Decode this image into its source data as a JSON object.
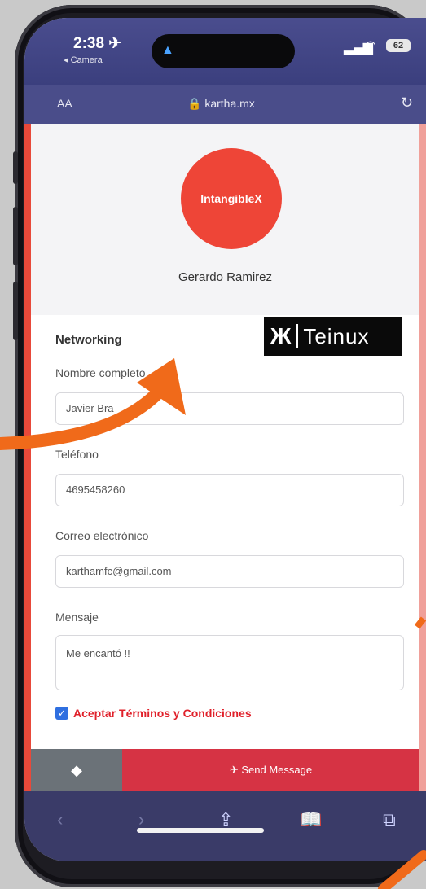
{
  "status": {
    "time": "2:38 ✈",
    "back_app": "◂ Camera",
    "battery": "62"
  },
  "browser": {
    "aa": "AA",
    "url": "🔒 kartha.mx",
    "reload": "↻"
  },
  "profile": {
    "logo_text": "IntangibleX",
    "name": "Gerardo Ramirez"
  },
  "form": {
    "section_title": "Networking",
    "sponsor": "Teinux",
    "fields": [
      {
        "label": "Nombre completo",
        "value": "Javier Bra"
      },
      {
        "label": "Teléfono",
        "value": "4695458260"
      },
      {
        "label": "Correo electrónico",
        "value": "karthamfc@gmail.com"
      },
      {
        "label": "Mensaje",
        "value": "Me encantó !!"
      }
    ],
    "terms": "Aceptar Términos y Condiciones",
    "back_btn": "◆",
    "send_btn": "✈ Send Message"
  },
  "toolbar": {
    "back": "‹",
    "forward": "›",
    "share": "⇪",
    "bookmarks": "📖",
    "tabs": "⧉"
  },
  "colors": {
    "accent": "#ee4537",
    "send": "#d63344",
    "arrow": "#f06a1a"
  }
}
